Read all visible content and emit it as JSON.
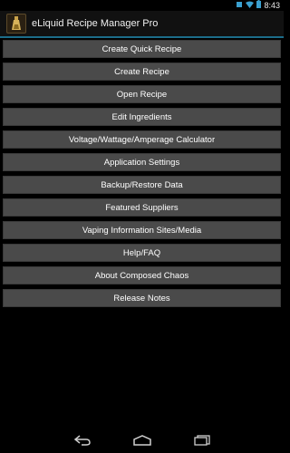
{
  "status": {
    "time": "8:43",
    "icons": [
      "wifi-icon",
      "battery-icon",
      "notification-icon"
    ]
  },
  "actionbar": {
    "title": "eLiquid Recipe Manager Pro",
    "icon": "app-bottle-icon"
  },
  "menu": {
    "items": [
      {
        "label": "Create Quick Recipe"
      },
      {
        "label": "Create Recipe"
      },
      {
        "label": "Open Recipe"
      },
      {
        "label": "Edit Ingredients"
      },
      {
        "label": "Voltage/Wattage/Amperage Calculator"
      },
      {
        "label": "Application Settings"
      },
      {
        "label": "Backup/Restore Data"
      },
      {
        "label": "Featured Suppliers"
      },
      {
        "label": "Vaping Information Sites/Media"
      },
      {
        "label": "Help/FAQ"
      },
      {
        "label": "About Composed Chaos"
      },
      {
        "label": "Release Notes"
      }
    ]
  },
  "navbar": {
    "buttons": [
      "back-icon",
      "home-icon",
      "recent-apps-icon"
    ]
  },
  "colors": {
    "accent": "#1c6d8a",
    "button": "#4a4a4a",
    "background": "#000000"
  }
}
